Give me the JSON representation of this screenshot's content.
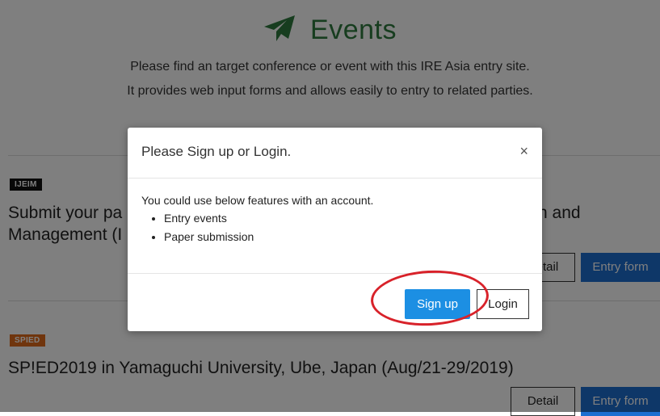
{
  "hero": {
    "title": "Events",
    "description_line1": "Please find an target conference or event with this IRE Asia entry site.",
    "description_line2": "It provides web input forms and allows easily to entry to related parties.",
    "icon": "paper-plane-icon",
    "accent_color": "#2f7a3e"
  },
  "events": [
    {
      "badge": "IJEIM",
      "badge_color": "#111111",
      "title_line1_left": "Submit your pa",
      "title_line1_right": "n and",
      "title_line2_left": "Management (I",
      "detail_label": "Detail",
      "detail_partial_label": "il",
      "entry_label": "Entry form"
    },
    {
      "badge": "SPIED",
      "badge_color": "#e06a1b",
      "title": "SP!ED2019 in Yamaguchi University, Ube, Japan (Aug/21-29/2019)",
      "detail_label": "Detail",
      "entry_label": "Entry form"
    }
  ],
  "modal": {
    "title": "Please Sign up or Login.",
    "close_symbol": "×",
    "body_text": "You could use below features with an account.",
    "features": [
      "Entry events",
      "Paper submission"
    ],
    "signup_label": "Sign up",
    "login_label": "Login",
    "signup_color": "#1c8fe3"
  },
  "annotation": {
    "highlight_color": "#d8222a"
  }
}
